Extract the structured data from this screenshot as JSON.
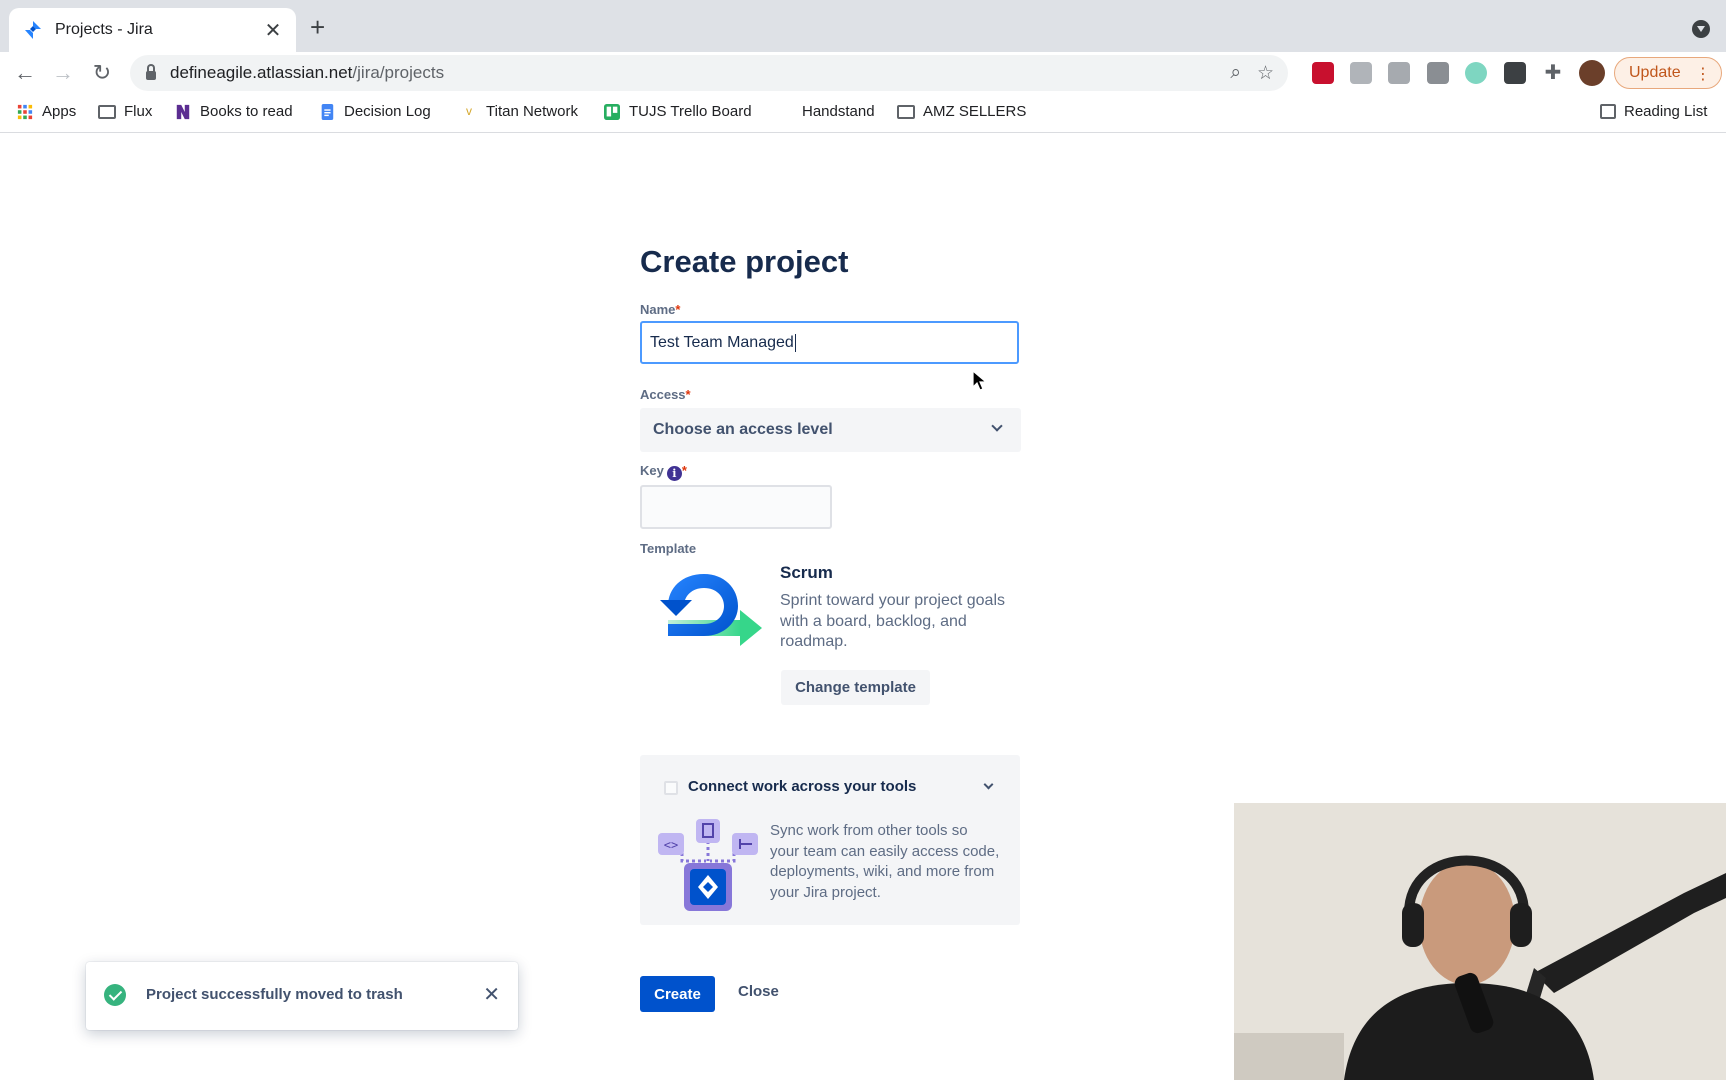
{
  "browser": {
    "tab_title": "Projects - Jira",
    "url_host": "defineagile.atlassian.net",
    "url_path": "/jira/projects",
    "update_label": "Update",
    "bookmarks": [
      {
        "label": "Apps",
        "icon": "apps-grid-icon"
      },
      {
        "label": "Flux",
        "icon": "folder-icon"
      },
      {
        "label": "Books to read",
        "icon": "bookmark-icon"
      },
      {
        "label": "Decision Log",
        "icon": "google-docs-icon"
      },
      {
        "label": "Titan Network",
        "icon": "titan-icon"
      },
      {
        "label": "TUJS Trello Board",
        "icon": "trello-icon"
      },
      {
        "label": "Handstand",
        "icon": "blank-icon"
      },
      {
        "label": "AMZ SELLERS",
        "icon": "folder-icon"
      }
    ],
    "reading_list": "Reading List"
  },
  "form": {
    "title": "Create project",
    "name_label": "Name",
    "name_value": "Test Team Managed",
    "access_label": "Access",
    "access_placeholder": "Choose an access level",
    "key_label": "Key",
    "key_value": "",
    "required_mark": "*",
    "info_glyph": "i",
    "template_label": "Template",
    "template_name": "Scrum",
    "template_desc": "Sprint toward your project goals with a board, backlog, and roadmap.",
    "change_template": "Change template",
    "connect_title": "Connect work across your tools",
    "connect_desc": "Sync work from other tools so your team can easily access code, deployments, wiki, and more from your Jira project.",
    "create_label": "Create",
    "close_label": "Close"
  },
  "toast": {
    "message": "Project successfully moved to trash"
  },
  "colors": {
    "primary": "#0052cc",
    "focus_border": "#4c9aff",
    "success": "#36b37e",
    "required": "#de350b"
  }
}
